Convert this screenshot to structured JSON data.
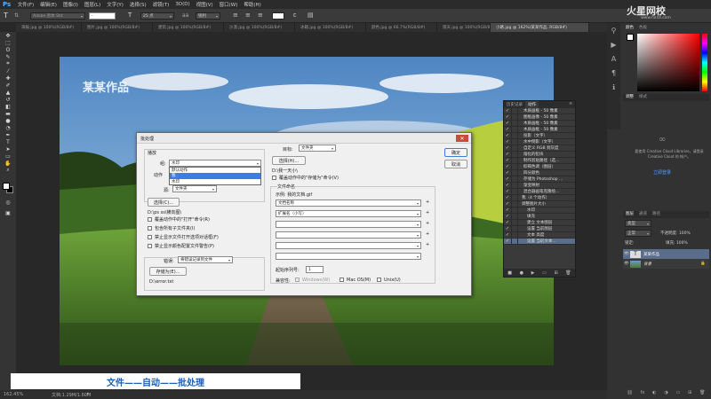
{
  "app": {
    "logo": "Ps"
  },
  "menu": [
    "文件(F)",
    "编辑(E)",
    "图像(I)",
    "图层(L)",
    "文字(Y)",
    "选择(S)",
    "滤镜(T)",
    "3D(D)",
    "视图(V)",
    "窗口(W)",
    "帮助(H)"
  ],
  "options": {
    "font_placeholder": "Adobe 黑体 Std",
    "style": "-",
    "size": "25 点",
    "aa": "锐利"
  },
  "tabs": [
    "海报.jpg @ 100%(RGB/8#)",
    "图片.jpg @ 100%(RGB/8#)",
    "建筑.jpg @ 100%(RGB/8#)",
    "沙漠.jpg @ 100%(RGB/8#)",
    "冰箱.jpg @ 100%(RGB/8#)",
    "颜色.jpg @ 66.7%(RGB/8#)",
    "雨天.jpg @ 100%(RGB/8#)",
    "小路.jpg @ 162%(某某作品, RGB/8#)"
  ],
  "canvas": {
    "watermark": "某某作品"
  },
  "caption": "文件——自动——批处理",
  "status": {
    "zoom": "162.45%",
    "doc": "文档:1.29M/1.60M"
  },
  "brand": {
    "name": "火星网校",
    "url": "www.hxsd.com"
  },
  "panels": {
    "color_tabs": [
      "颜色",
      "色板"
    ],
    "adjust_tabs": [
      "调整",
      "样式"
    ],
    "cc_text": "要使用 Creative Cloud Libraries，请登录 Creative Cloud 的 帐户。",
    "cc_login": "立即登录",
    "layers_tabs": [
      "图层",
      "通道",
      "路径"
    ],
    "layers_kind": "类型",
    "layers_mode": "正常",
    "layers_opacity": "不透明度: 100%",
    "layers_lock": "锁定:",
    "layers_fill": "填充: 100%",
    "layers": [
      {
        "name": "某某作品",
        "type": "T"
      },
      {
        "name": "背景",
        "type": "img"
      }
    ]
  },
  "actions_panel": {
    "tabs": [
      "历史记录",
      "动作"
    ],
    "items": [
      "木质画框 - 50 像素",
      "图框画像 - 50 像素",
      "木质画框 - 50 像素",
      "木质画框 - 50 像素",
      "投影（文字）",
      "水中倒影（文字）",
      "自定义 RGB 到灰度",
      "熔化的铅块",
      "制作剪贴路径（选...",
      "棕褐色调（图层）",
      "四分颜色",
      "存储为 Photoshop ...",
      "渐变映射",
      "混合器画笔克隆绘...",
      "我（4 个动作）",
      "调整图片大小",
      "水印",
      "填充",
      "建立 文本图层",
      "设置 当前图层",
      "文本 高度",
      "设置 当前文本..."
    ]
  },
  "dialog": {
    "title": "批处理",
    "play_label": "播放",
    "set_label": "组:",
    "set_value": "水印",
    "action_label": "动作",
    "action_options": [
      "默认动作",
      "我",
      "水印"
    ],
    "source_label": "源:",
    "source_value": "文件夹",
    "choose": "选择(C)...",
    "source_path": "D:\\ps ss\\横向图\\",
    "opts": [
      "覆盖动作中的\"打开\"命令(R)",
      "包含所有子文件夹(I)",
      "禁止显示文件打开选项对话框(F)",
      "禁止显示颜色配置文件警告(P)"
    ],
    "errors_label": "错误:",
    "errors_value": "将错误记录到文件",
    "save_as": "存储为(E)...",
    "error_path": "D:\\error.txt",
    "dest_label": "目标:",
    "dest_value": "文件夹",
    "choose2": "选择(H)...",
    "dest_path": "D:\\我一天小\\",
    "override_save": "覆盖动作中的\"存储为\"命令(V)",
    "naming_title": "文件命名",
    "example": "示例: 我的文档.gif",
    "naming_fields": [
      "文档名称",
      "扩展名（小写）",
      "",
      "",
      "",
      ""
    ],
    "serial_label": "起始序列号:",
    "serial_value": "1",
    "compat_label": "兼容性:",
    "compat": [
      "Windows(W)",
      "Mac OS(M)",
      "Unix(U)"
    ],
    "ok": "确定",
    "cancel": "取消"
  },
  "colors": {
    "fg": "#ffffff",
    "bg": "#000000",
    "selection": "#3c7ee0"
  }
}
